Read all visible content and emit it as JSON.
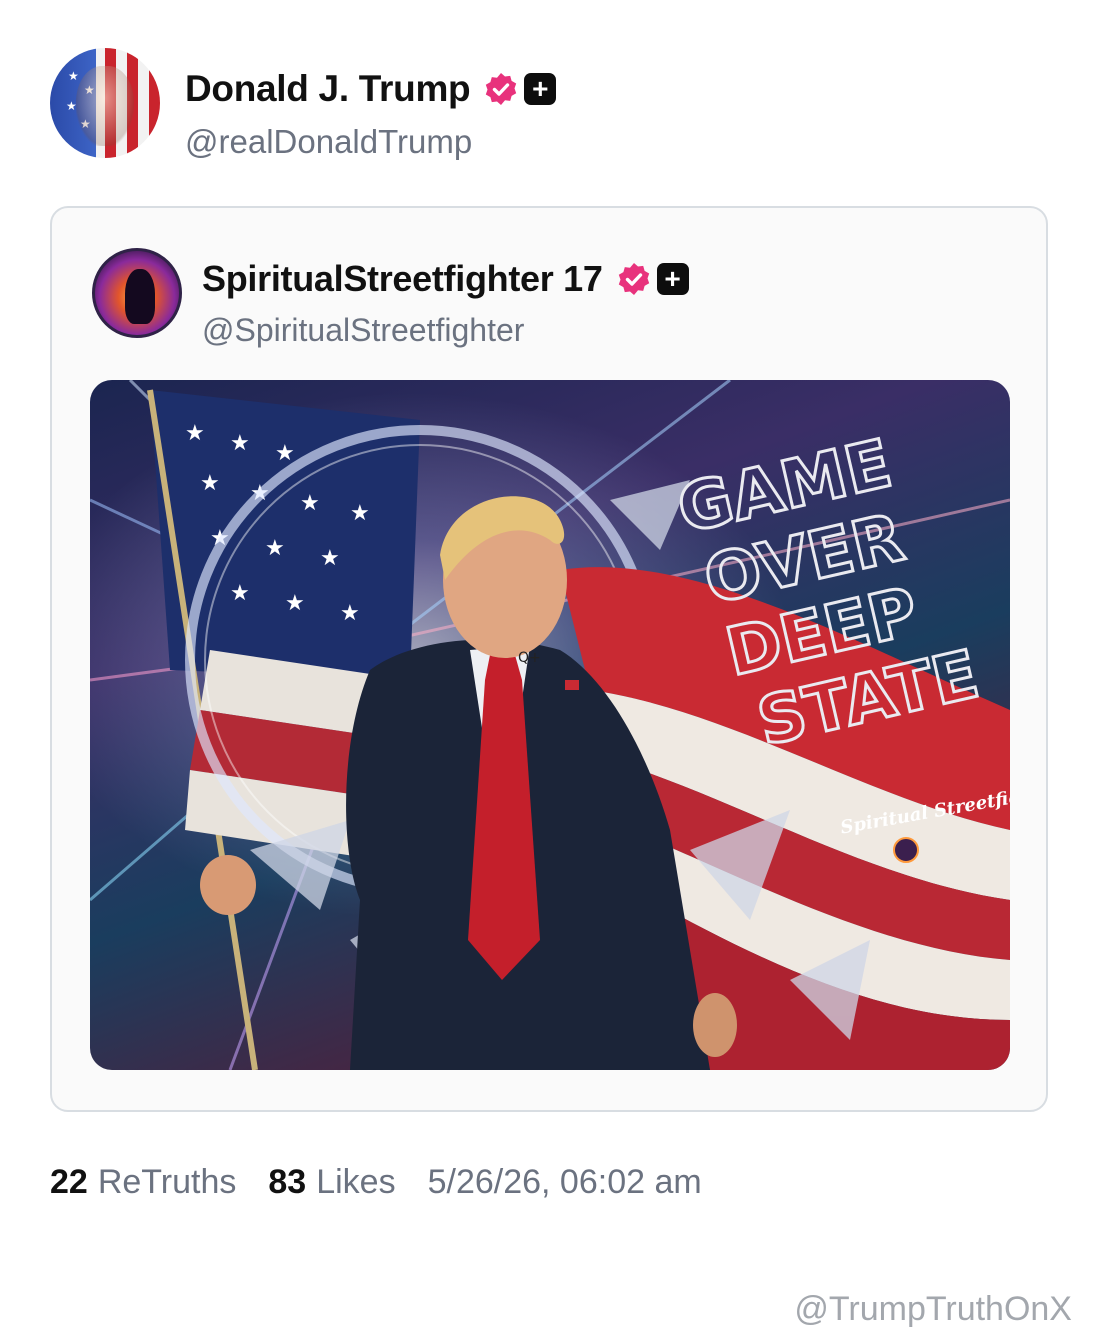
{
  "post": {
    "author": {
      "display_name": "Donald J. Trump",
      "handle": "@realDonaldTrump",
      "verified": true
    },
    "quoted": {
      "author": {
        "display_name": "SpiritualStreetfighter 17",
        "handle": "@SpiritualStreetfighter",
        "verified": true
      },
      "image": {
        "headline_lines": [
          "GAME",
          "OVER",
          "DEEP",
          "STATE"
        ],
        "signature": "Spiritual Streetfighter",
        "pin_text": "Q+"
      }
    },
    "stats": {
      "retruths_count": "22",
      "retruths_label": "ReTruths",
      "likes_count": "83",
      "likes_label": "Likes",
      "timestamp": "5/26/26, 06:02 am"
    }
  },
  "watermark": "@TrumpTruthOnX",
  "colors": {
    "verified_badge": "#e8327c",
    "plus_badge": "#0d0d0d",
    "muted_text": "#6b7280",
    "card_border": "#d8dde2"
  }
}
